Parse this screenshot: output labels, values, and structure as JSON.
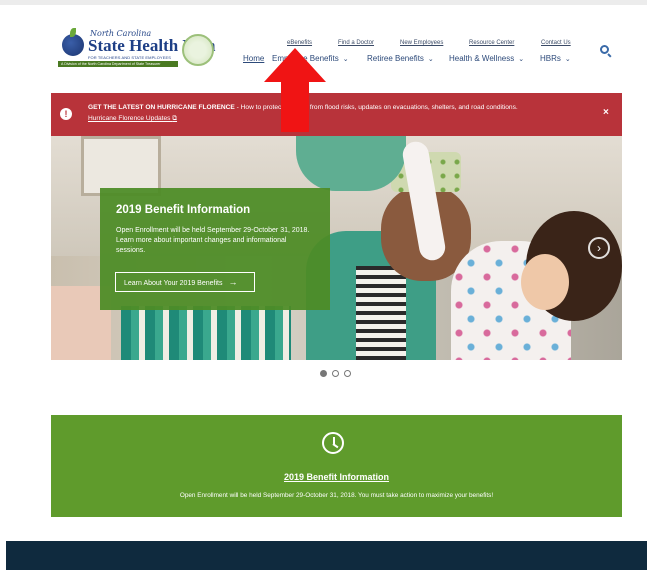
{
  "header": {
    "logo": {
      "script": "North Carolina",
      "name": "State Health Plan",
      "tagline": "FOR TEACHERS AND STATE EMPLOYEES",
      "subbar": "A Division of the North Carolina Department of State Treasurer"
    },
    "utility_links": [
      "eBenefits",
      "Find a Doctor",
      "New Employees",
      "Resource Center",
      "Contact Us"
    ],
    "nav": [
      {
        "label": "Home",
        "has_menu": false
      },
      {
        "label": "Employee Benefits",
        "has_menu": true
      },
      {
        "label": "Retiree Benefits",
        "has_menu": true
      },
      {
        "label": "Health & Wellness",
        "has_menu": true
      },
      {
        "label": "HBRs",
        "has_menu": true
      }
    ],
    "search_icon": "search-icon"
  },
  "alert": {
    "icon": "alert-icon",
    "headline": "GET THE LATEST ON HURRICANE FLORENCE",
    "text": " - How to protect yourself from flood risks, updates on evacuations, shelters, and road conditions.",
    "link": "Hurricane Florence Updates",
    "link_icon": "external-link-icon",
    "close": "×"
  },
  "hero": {
    "promo": {
      "title": "2019 Benefit Information",
      "body": "Open Enrollment will be held September 29-October 31, 2018. Learn more about important changes and informational sessions.",
      "button": "Learn About Your 2019 Benefits",
      "button_icon": "arrow-right-icon"
    },
    "next_icon": "chevron-right-icon"
  },
  "carousel": {
    "slides": 3,
    "active": 0
  },
  "banner": {
    "icon": "clock-icon",
    "title": "2019 Benefit Information",
    "body": "Open Enrollment will be held September 29-October 31, 2018. You must take action to maximize your benefits!"
  },
  "colors": {
    "alert": "#b8333a",
    "green": "#5f9b2c",
    "navy": "#0f2a3e",
    "annotation_arrow": "#f01414"
  }
}
